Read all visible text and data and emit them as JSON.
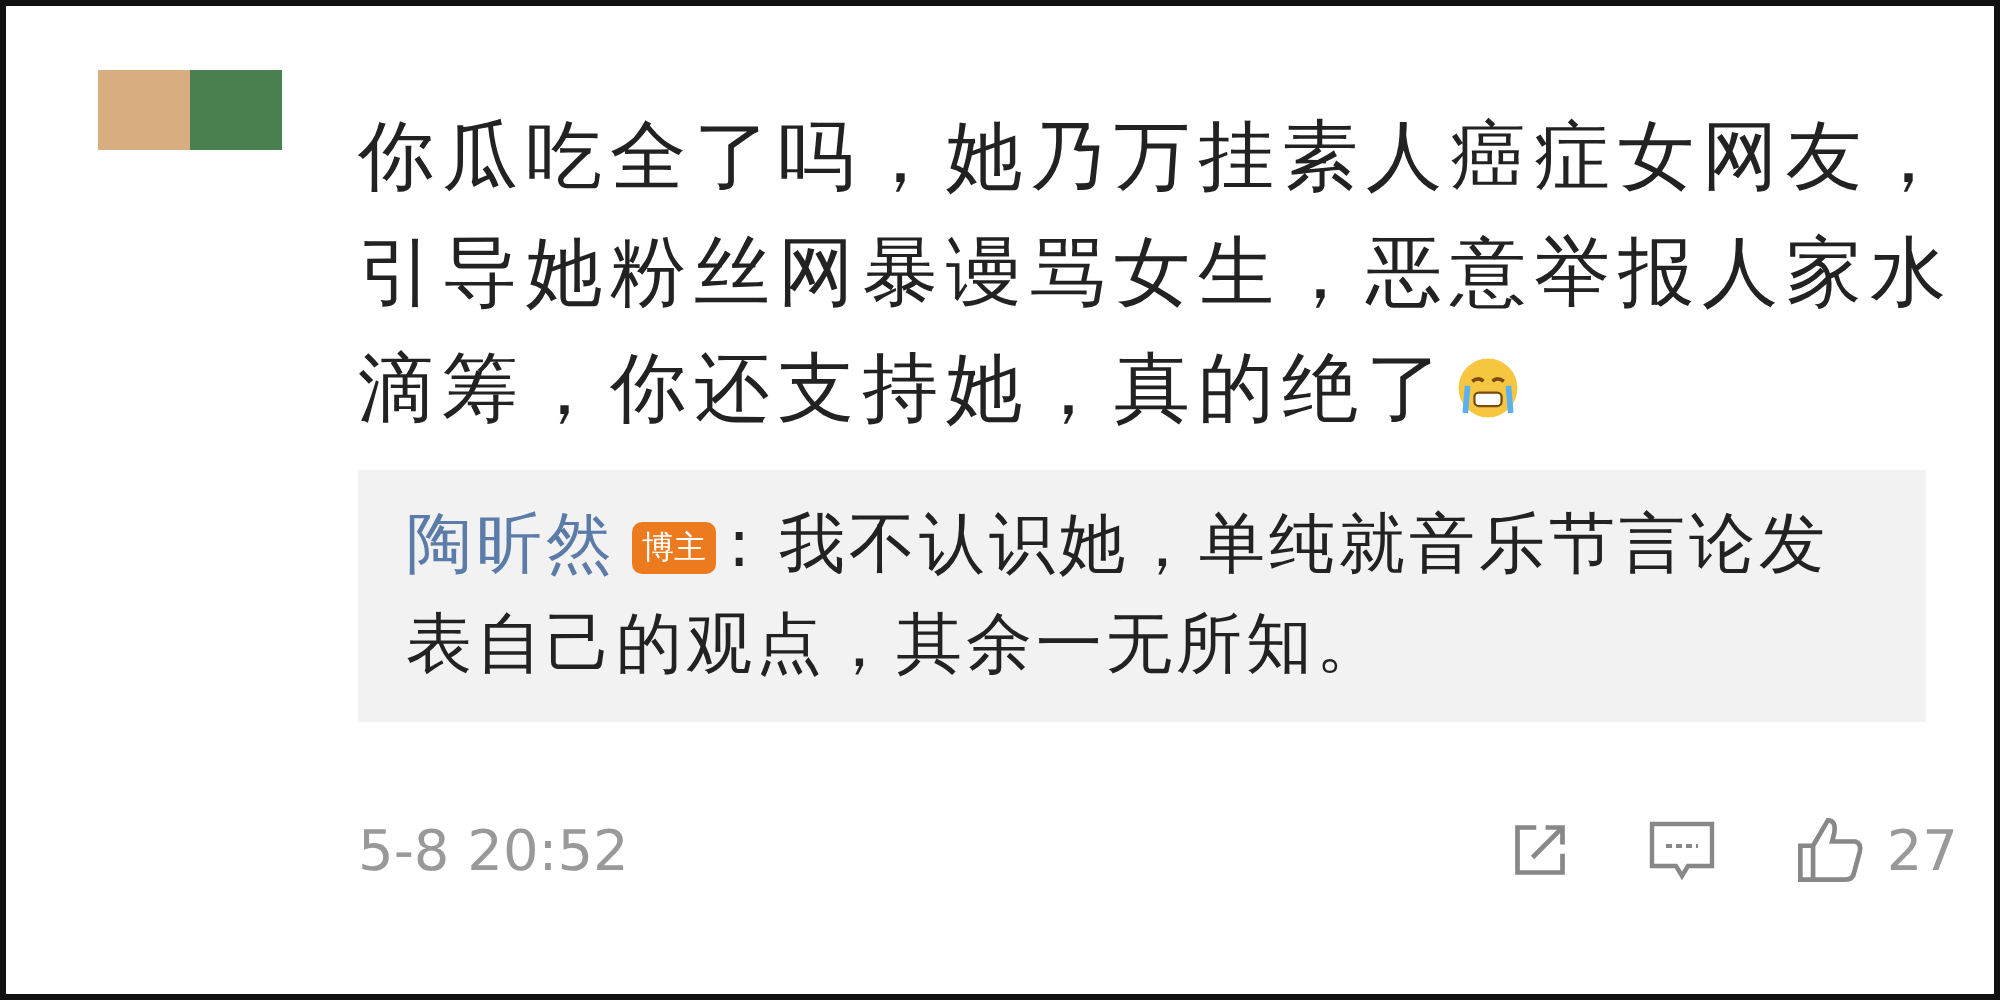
{
  "comment": {
    "text": "你瓜吃全了吗，她乃万挂素人癌症女网友，引导她粉丝网暴谩骂女生，恶意举报人家水滴筹，你还支持她，真的绝了",
    "redactions": [
      {
        "color": "#d8ad80"
      },
      {
        "color": "#4a8050"
      }
    ]
  },
  "reply": {
    "author": "陶昕然",
    "badge": "博主",
    "text": ": 我不认识她，单纯就音乐节言论发表自己的观点，其余一无所知。"
  },
  "footer": {
    "time": "5-8 20:52",
    "likes": "27"
  }
}
